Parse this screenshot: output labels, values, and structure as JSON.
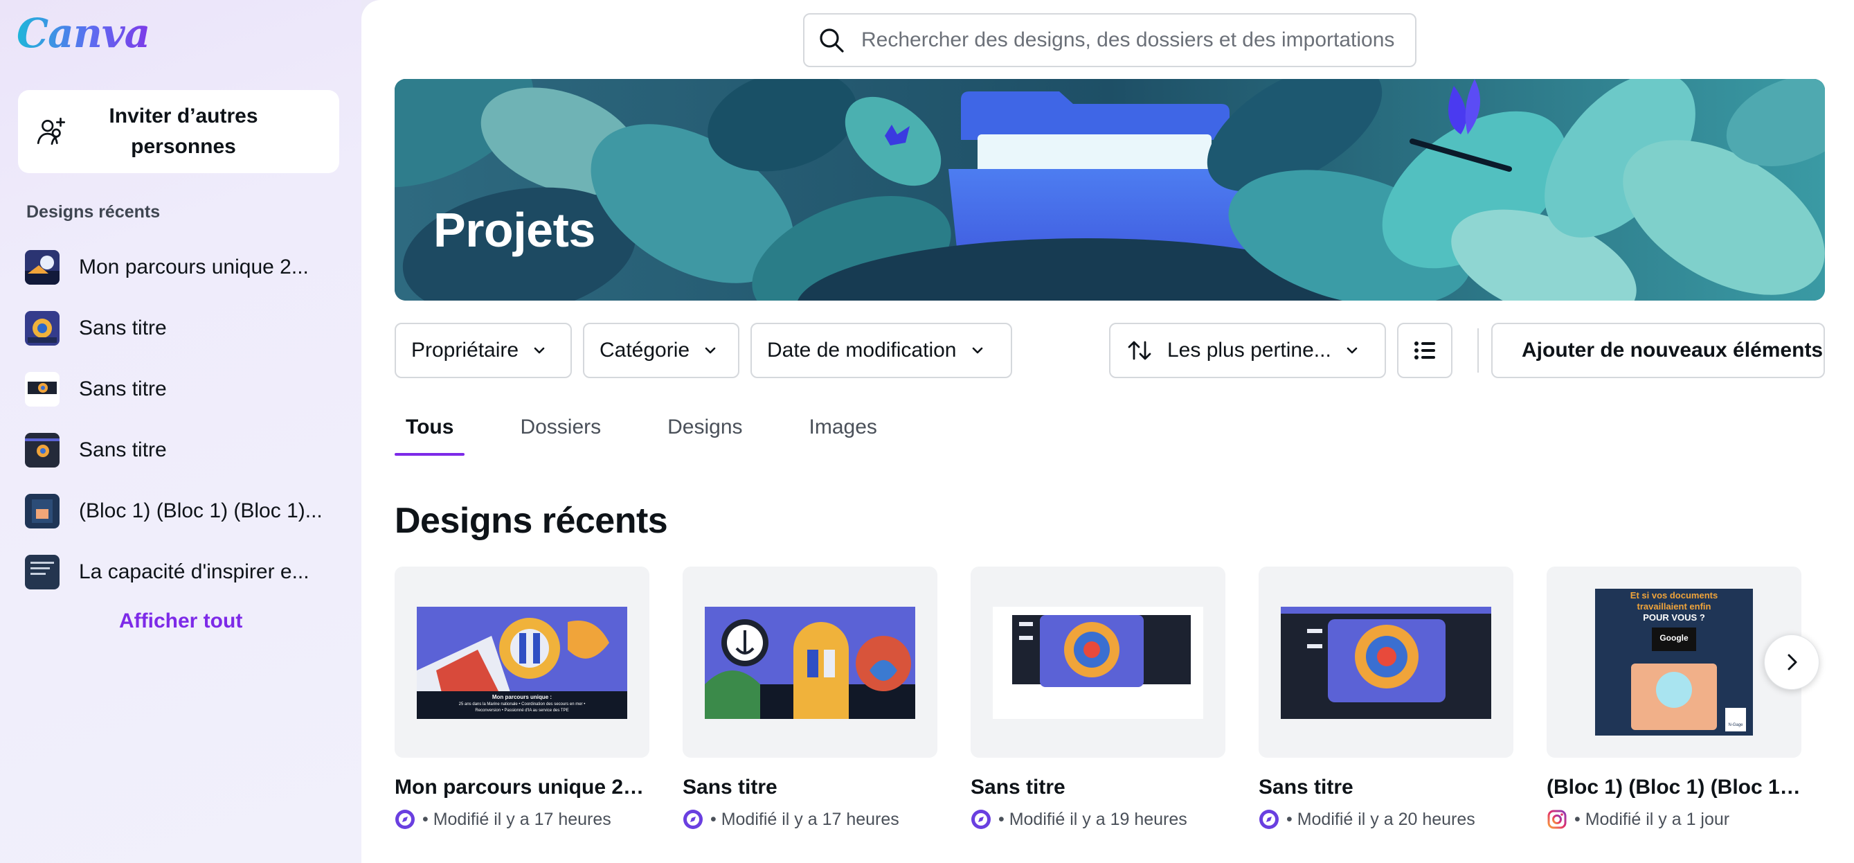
{
  "brand": {
    "logo_text": "Canva",
    "accent": "#7d2ae8"
  },
  "sidebar": {
    "invite_label": "Inviter d’autres personnes",
    "invite_icon": "add-people-icon",
    "recent_title": "Designs récents",
    "items": [
      {
        "label": "Mon parcours unique 2..."
      },
      {
        "label": "Sans titre"
      },
      {
        "label": "Sans titre"
      },
      {
        "label": "Sans titre"
      },
      {
        "label": "(Bloc 1) (Bloc 1) (Bloc 1)..."
      },
      {
        "label": "La capacité d'inspirer e..."
      }
    ],
    "show_all": "Afficher tout"
  },
  "search": {
    "placeholder": "Rechercher des designs, des dossiers et des importations",
    "value": ""
  },
  "hero": {
    "title": "Projets"
  },
  "filters": {
    "owner": "Propriétaire",
    "category": "Catégorie",
    "modified": "Date de modification",
    "sort": "Les plus pertine...",
    "add": "Ajouter de nouveaux éléments"
  },
  "tabs": [
    {
      "label": "Tous",
      "active": true
    },
    {
      "label": "Dossiers"
    },
    {
      "label": "Designs"
    },
    {
      "label": "Images"
    }
  ],
  "section_title": "Designs récents",
  "cards": [
    {
      "title": "Mon parcours unique 25...",
      "meta": "• Modifié il y a 17 heures",
      "badge": "edit-badge-icon",
      "caption1": "Mon parcours unique :",
      "caption2": "25 ans dans la Marine nationale • Coordination des secours en mer •",
      "caption3": "Reconversion • Passionné d'IA au service des TPE"
    },
    {
      "title": "Sans titre",
      "meta": "• Modifié il y a 17 heures",
      "badge": "edit-badge-icon"
    },
    {
      "title": "Sans titre",
      "meta": "• Modifié il y a 19 heures",
      "badge": "edit-badge-icon"
    },
    {
      "title": "Sans titre",
      "meta": "• Modifié il y a 20 heures",
      "badge": "edit-badge-icon"
    },
    {
      "title": "(Bloc 1) (Bloc 1) (Bloc 1) ...",
      "meta": "• Modifié il y a 1 jour",
      "badge": "instagram-icon",
      "caption1": "Et si vos documents",
      "caption2": "travaillaient enfin",
      "caption3": "POUR VOUS ?",
      "brand": "Google",
      "logo": "N-Gage"
    }
  ]
}
